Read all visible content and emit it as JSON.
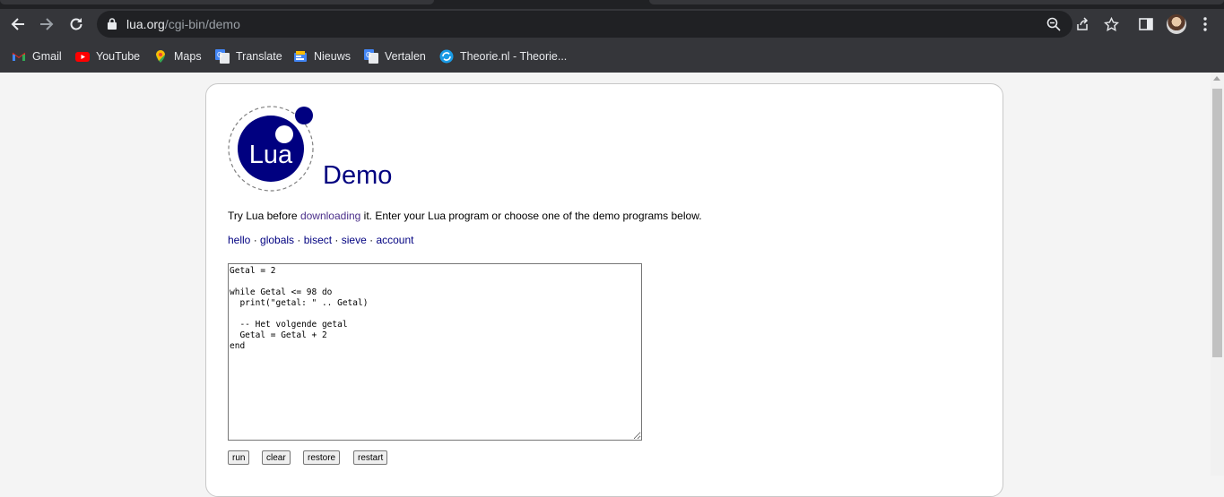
{
  "browser": {
    "url_host": "lua.org",
    "url_path": "/cgi-bin/demo"
  },
  "bookmarks": [
    {
      "label": "Gmail",
      "icon": "gmail-icon"
    },
    {
      "label": "YouTube",
      "icon": "youtube-icon"
    },
    {
      "label": "Maps",
      "icon": "maps-icon"
    },
    {
      "label": "Translate",
      "icon": "translate-icon"
    },
    {
      "label": "Nieuws",
      "icon": "news-icon"
    },
    {
      "label": "Vertalen",
      "icon": "translate-icon"
    },
    {
      "label": "Theorie.nl - Theorie...",
      "icon": "theorie-icon"
    }
  ],
  "page": {
    "logo_text": "Lua",
    "title": "Demo",
    "intro_before": "Try Lua before ",
    "intro_link": "downloading",
    "intro_after": " it. Enter your Lua program or choose one of the demo programs below.",
    "demos": [
      "hello",
      "globals",
      "bisect",
      "sieve",
      "account"
    ],
    "separator": " · ",
    "code": "Getal = 2\n\nwhile Getal <= 98 do\n  print(\"getal: \" .. Getal)\n\n  -- Het volgende getal\n  Getal = Getal + 2\nend",
    "buttons": {
      "run": "run",
      "clear": "clear",
      "restore": "restore",
      "restart": "restart"
    }
  },
  "colors": {
    "lua_blue": "#000080",
    "link_visited": "#4b2f8a",
    "chrome_dark": "#35363a"
  }
}
